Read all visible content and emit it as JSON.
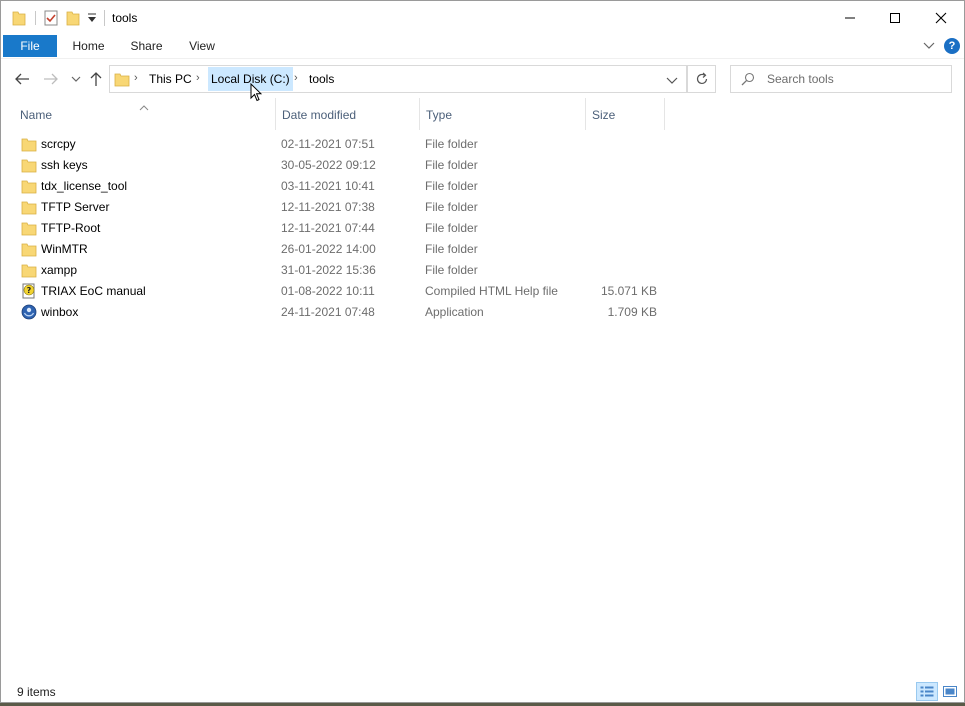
{
  "window": {
    "title": "tools"
  },
  "ribbon": {
    "tabs": [
      {
        "label": "File"
      },
      {
        "label": "Home"
      },
      {
        "label": "Share"
      },
      {
        "label": "View"
      }
    ],
    "help_label": "?"
  },
  "address": {
    "crumbs": [
      {
        "label": "This PC"
      },
      {
        "label": "Local Disk (C:)"
      },
      {
        "label": "tools"
      }
    ]
  },
  "search": {
    "placeholder": "Search tools"
  },
  "columns": {
    "name": "Name",
    "date": "Date modified",
    "type": "Type",
    "size": "Size"
  },
  "files": [
    {
      "name": "scrcpy",
      "date": "02-11-2021 07:51",
      "type": "File folder",
      "size": "",
      "icon": "folder-icon"
    },
    {
      "name": "ssh keys",
      "date": "30-05-2022 09:12",
      "type": "File folder",
      "size": "",
      "icon": "folder-icon"
    },
    {
      "name": "tdx_license_tool",
      "date": "03-11-2021 10:41",
      "type": "File folder",
      "size": "",
      "icon": "folder-icon"
    },
    {
      "name": "TFTP Server",
      "date": "12-11-2021 07:38",
      "type": "File folder",
      "size": "",
      "icon": "folder-icon"
    },
    {
      "name": "TFTP-Root",
      "date": "12-11-2021 07:44",
      "type": "File folder",
      "size": "",
      "icon": "folder-icon"
    },
    {
      "name": "WinMTR",
      "date": "26-01-2022 14:00",
      "type": "File folder",
      "size": "",
      "icon": "folder-icon"
    },
    {
      "name": "xampp",
      "date": "31-01-2022 15:36",
      "type": "File folder",
      "size": "",
      "icon": "folder-icon"
    },
    {
      "name": "TRIAX EoC manual",
      "date": "01-08-2022 10:11",
      "type": "Compiled HTML Help file",
      "size": "15.071 KB",
      "icon": "help-file-icon"
    },
    {
      "name": "winbox",
      "date": "24-11-2021 07:48",
      "type": "Application",
      "size": "1.709 KB",
      "icon": "application-icon"
    }
  ],
  "status": {
    "item_count": "9 items"
  },
  "colors": {
    "file_tab": "#1979ca",
    "folder": "#f8d775",
    "selection": "#cce8ff",
    "header_text": "#4c607a"
  }
}
